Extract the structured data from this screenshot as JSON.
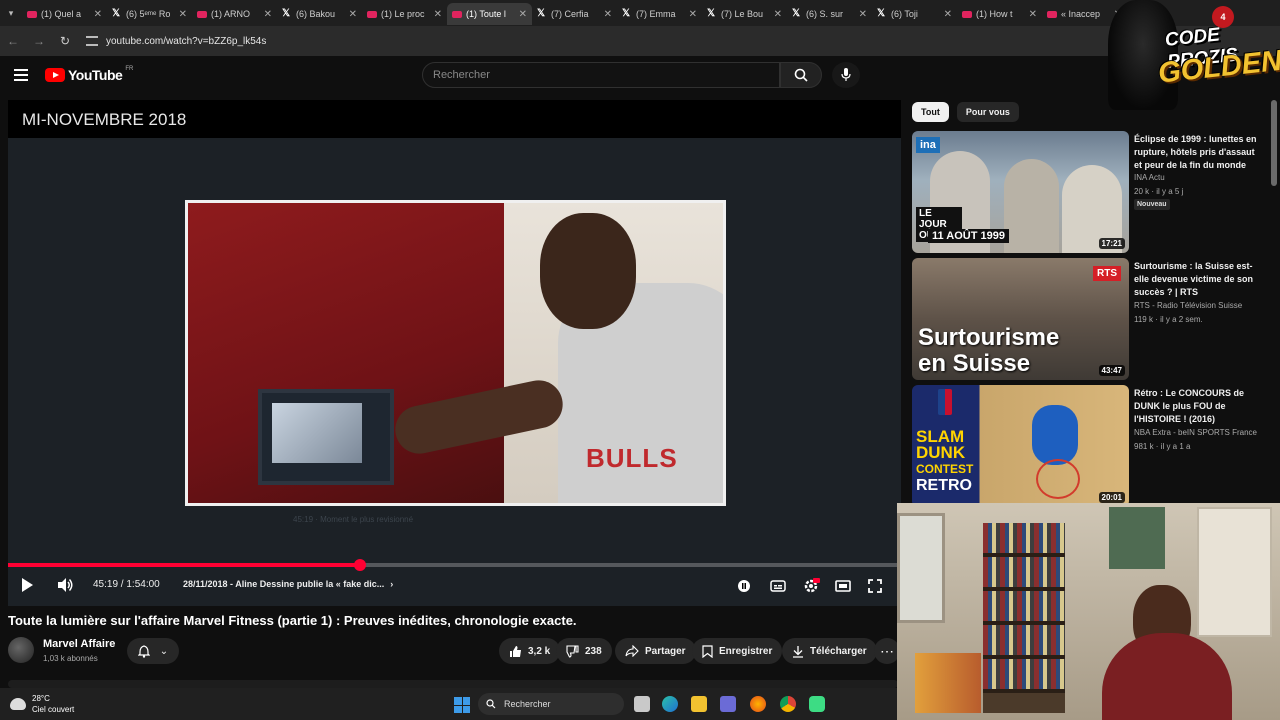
{
  "browser": {
    "tabs": [
      {
        "label": "(1) Quel a",
        "icon": "youtube",
        "active": false
      },
      {
        "label": "(6) 5ᵉᵐᵉ Ro",
        "icon": "x",
        "active": false
      },
      {
        "label": "(1) ARNO",
        "icon": "youtube",
        "active": false
      },
      {
        "label": "(6) Bakou",
        "icon": "x",
        "active": false
      },
      {
        "label": "(1) Le proc",
        "icon": "youtube",
        "active": false
      },
      {
        "label": "(1) Toute l",
        "icon": "youtube",
        "active": true
      },
      {
        "label": "(7) Cerfia",
        "icon": "x",
        "active": false
      },
      {
        "label": "(7) Emma",
        "icon": "x",
        "active": false
      },
      {
        "label": "(7) Le Bou",
        "icon": "x",
        "active": false
      },
      {
        "label": "(6) S. sur",
        "icon": "x",
        "active": false
      },
      {
        "label": "(6) Toji",
        "icon": "x",
        "active": false
      },
      {
        "label": "(1) How t",
        "icon": "youtube",
        "active": false
      },
      {
        "label": "« Inaccep",
        "icon": "youtube",
        "active": false
      }
    ],
    "url": "youtube.com/watch?v=bZZ6p_lk54s"
  },
  "youtube": {
    "logo_text": "YouTube",
    "region": "FR",
    "search_placeholder": "Rechercher"
  },
  "player": {
    "chapter_title": "MI-NOVEMBRE 2018",
    "faded_caption": "45:19 · Moment le plus revisionné",
    "time": "45:19 / 1:54:00",
    "chapter": "28/11/2018 - Aline Dessine publie la « fake dic...",
    "shirt_text": "BULLS",
    "progress_fraction": 0.394,
    "accent": "#ff0033"
  },
  "video": {
    "title": "Toute la lumière sur l'affaire Marvel Fitness (partie 1) : Preuves inédites, chronologie exacte.",
    "channel": "Marvel Affaire",
    "subscribers": "1,03 k abonnés",
    "likes": "3,2 k",
    "dislikes": "238",
    "share_label": "Partager",
    "save_label": "Enregistrer",
    "download_label": "Télécharger"
  },
  "sidebar": {
    "chips": [
      "Tout",
      "Pour vous"
    ],
    "recommendations": [
      {
        "title": "Éclipse de 1999 : lunettes en rupture, hôtels pris d'assaut et peur de la fin du monde",
        "channel": "INA Actu",
        "meta": "20 k · il y a 5 j",
        "badge": "Nouveau",
        "duration": "17:21",
        "thumb_text_1": "ina",
        "thumb_text_2": "LE JOUR OÙ",
        "thumb_text_3": "11 AOÛT 1999"
      },
      {
        "title": "Surtourisme : la Suisse est-elle devenue victime de son succès ? | RTS",
        "channel": "RTS - Radio Télévision Suisse",
        "meta": "119 k · il y a 2 sem.",
        "duration": "43:47",
        "thumb_text_1": "RTS",
        "thumb_text_2": "Surtourisme",
        "thumb_text_3": "en Suisse"
      },
      {
        "title": "Rétro : Le CONCOURS de DUNK le plus FOU de l'HISTOIRE ! (2016)",
        "channel": "NBA Extra - beIN SPORTS France",
        "meta": "981 k · il y a 1 a",
        "duration": "20:01",
        "thumb_text_1": "SLAM",
        "thumb_text_2": "DUNK",
        "thumb_text_3": "CONTEST",
        "thumb_text_4": "RETRO"
      }
    ]
  },
  "overlay": {
    "line1": "CODE PROZIS",
    "line2": "GOLDENG",
    "badge": "4"
  },
  "taskbar": {
    "temperature": "28°C",
    "weather": "Ciel couvert",
    "search_label": "Rechercher"
  }
}
